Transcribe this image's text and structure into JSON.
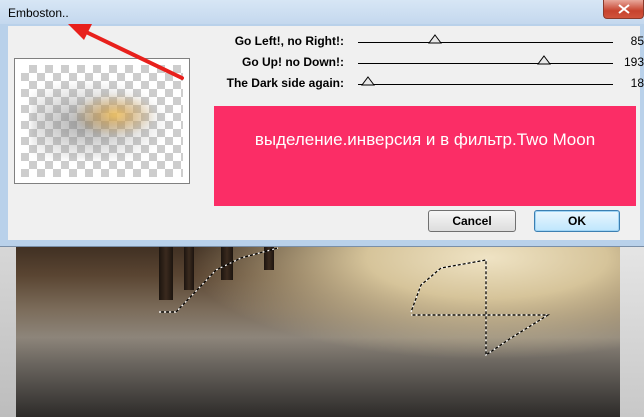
{
  "dialog": {
    "title": "Emboston..",
    "sliders": [
      {
        "label": "Go Left!, no Right!:",
        "value": "85"
      },
      {
        "label": "Go Up! no Down!:",
        "value": "193"
      },
      {
        "label": "The Dark side again:",
        "value": "18"
      }
    ],
    "cancel_label": "Cancel",
    "ok_label": "OK",
    "close_icon": "close-icon"
  },
  "annotation": {
    "text": "выделение.инверсия и в фильтр.Two Moon",
    "color": "#fb2d66",
    "arrow_color": "#e8201c"
  },
  "colors": {
    "titlebar": "#c4d8ee",
    "client": "#f0f0f0",
    "close_button": "#c7432e"
  }
}
